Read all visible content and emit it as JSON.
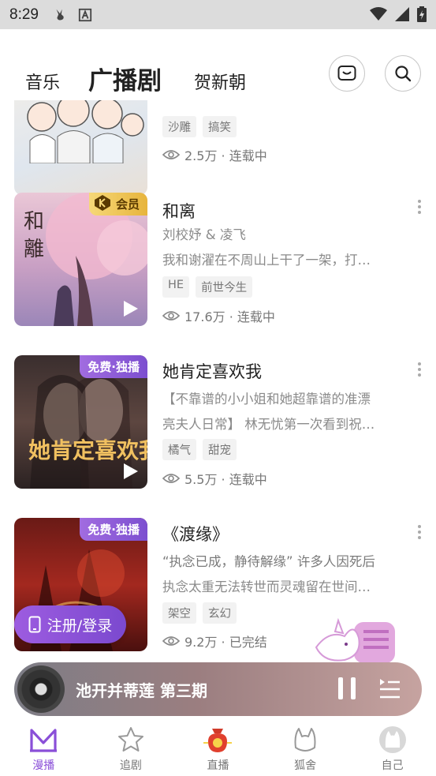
{
  "status_bar": {
    "time": "8:29"
  },
  "top_nav": {
    "tabs": [
      {
        "label": "音乐"
      },
      {
        "label": "广播剧"
      },
      {
        "label": "贺新朝"
      }
    ]
  },
  "feed": {
    "items": [
      {
        "title": "",
        "subtitle": "",
        "tags": [
          "沙雕",
          "搞笑"
        ],
        "views": "2.5万 · 连载中",
        "badge": ""
      },
      {
        "title": "和离",
        "subtitle": "刘校妤 & 凌飞",
        "desc": "我和谢濯在不周山上干了一架，打…",
        "tags": [
          "HE",
          "前世今生"
        ],
        "views": "17.6万 · 连载中",
        "badge": "会员"
      },
      {
        "title": "她肯定喜欢我",
        "subtitle": "【不靠谱的小小姐和她超靠谱的准漂",
        "desc": "亮夫人日常】 林无忧第一次看到祝…",
        "tags": [
          "橘气",
          "甜宠"
        ],
        "views": "5.5万 · 连载中",
        "badge": "免费·独播"
      },
      {
        "title": "《渡缘》",
        "subtitle": "“执念已成，静待解缘” 许多人因死后",
        "desc": "执念太重无法转世而灵魂留在世间…",
        "tags": [
          "架空",
          "玄幻"
        ],
        "views": "9.2万 · 已完结",
        "badge": "免费·独播"
      }
    ]
  },
  "login_pill": {
    "label": "注册/登录"
  },
  "player": {
    "title": "池开并蒂莲 第三期"
  },
  "bottom_nav": {
    "items": [
      {
        "label": "漫播",
        "icon": "manbo-icon",
        "active": true
      },
      {
        "label": "追剧",
        "icon": "star-icon"
      },
      {
        "label": "直播",
        "icon": "live-bag-icon"
      },
      {
        "label": "狐舍",
        "icon": "fox-icon"
      },
      {
        "label": "自己",
        "icon": "avatar-icon"
      }
    ]
  },
  "colors": {
    "accent": "#8a4fd8",
    "member": "#e7b43c"
  }
}
